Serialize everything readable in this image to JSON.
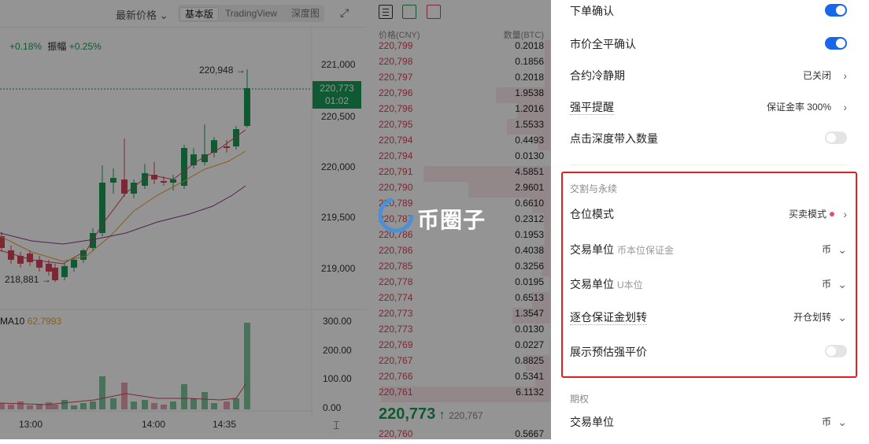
{
  "chart": {
    "price_type": "最新价格",
    "tabs": [
      "基本版",
      "TradingView",
      "深度图"
    ],
    "stat_change_value": "+0.18%",
    "stat_amplitude_label": "振幅",
    "stat_amplitude_value": "+0.25%",
    "high_label": "220,948 →",
    "low_label": "218,881 →",
    "current_price": "220,773",
    "current_time": "01:02",
    "price_ticks": [
      "221,000",
      "220,500",
      "220,000",
      "219,500",
      "219,000"
    ],
    "ma_label": "MA10",
    "ma_value": "62.7993",
    "vol_ticks": [
      "300.00",
      "200.00",
      "100.00",
      "0.00"
    ],
    "time_ticks": [
      "13:00",
      "14:00",
      "14:35"
    ]
  },
  "orderbook": {
    "col_price": "价格(CNY)",
    "col_qty": "数量(BTC)",
    "asks": [
      {
        "p": "220,799",
        "q": "0.2018"
      },
      {
        "p": "220,798",
        "q": "0.1856"
      },
      {
        "p": "220,797",
        "q": "0.2018"
      },
      {
        "p": "220,796",
        "q": "1.9538"
      },
      {
        "p": "220,796",
        "q": "1.2016"
      },
      {
        "p": "220,795",
        "q": "1.5533"
      },
      {
        "p": "220,794",
        "q": "0.4493"
      },
      {
        "p": "220,794",
        "q": "0.0130"
      },
      {
        "p": "220,791",
        "q": "4.5851"
      },
      {
        "p": "220,790",
        "q": "2.9601"
      },
      {
        "p": "220,789",
        "q": "0.6610"
      },
      {
        "p": "220,787",
        "q": "0.2312"
      },
      {
        "p": "220,786",
        "q": "0.1953"
      },
      {
        "p": "220,786",
        "q": "0.4038"
      },
      {
        "p": "220,785",
        "q": "0.3256"
      },
      {
        "p": "220,778",
        "q": "0.0195"
      },
      {
        "p": "220,774",
        "q": "0.6513"
      },
      {
        "p": "220,773",
        "q": "1.3547"
      },
      {
        "p": "220,773",
        "q": "0.0130"
      },
      {
        "p": "220,769",
        "q": "0.0227"
      },
      {
        "p": "220,767",
        "q": "0.8825"
      },
      {
        "p": "220,766",
        "q": "0.5341"
      },
      {
        "p": "220,761",
        "q": "6.1132"
      }
    ],
    "last_price": "220,773",
    "last_price_ref": "220,767",
    "bid_price": "220,760",
    "bid_qty": "0.5667"
  },
  "watermark": "币圈子",
  "settings": {
    "order_confirm": "下单确认",
    "market_close_confirm": "市价全平确认",
    "cooldown": {
      "label": "合约冷静期",
      "value": "已关闭"
    },
    "liq_alert": {
      "label": "强平提醒",
      "value": "保证金率 300%"
    },
    "depth_click": "点击深度带入数量",
    "section_delivery": "交割与永续",
    "position_mode": {
      "label": "仓位模式",
      "value": "买卖模式"
    },
    "unit_coin": {
      "label": "交易单位",
      "sub": "币本位保证金",
      "value": "币"
    },
    "unit_u": {
      "label": "交易单位",
      "sub": "U本位",
      "value": "币"
    },
    "isolated_transfer": {
      "label": "逐仓保证金划转",
      "value": "开仓划转"
    },
    "show_liq_price": "展示预估强平价",
    "section_options": "期权",
    "options_unit": {
      "label": "交易单位",
      "value": "币"
    }
  }
}
